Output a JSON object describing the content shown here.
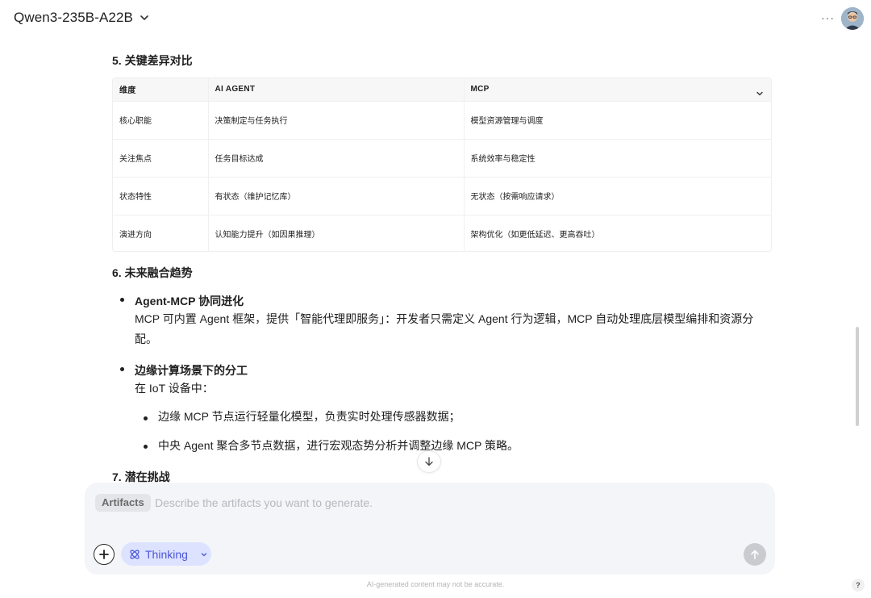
{
  "header": {
    "model_name": "Qwen3-235B-A22B",
    "more_label": "···"
  },
  "content": {
    "section5_title": "5. 关键差异对比",
    "table": {
      "headers": [
        "维度",
        "AI AGENT",
        "MCP"
      ],
      "rows": [
        [
          "核心职能",
          "决策制定与任务执行",
          "模型资源管理与调度"
        ],
        [
          "关注焦点",
          "任务目标达成",
          "系统效率与稳定性"
        ],
        [
          "状态特性",
          "有状态（维护记忆库）",
          "无状态（按需响应请求）"
        ],
        [
          "演进方向",
          "认知能力提升（如因果推理）",
          "架构优化（如更低延迟、更高吞吐）"
        ]
      ]
    },
    "section6_title": "6. 未来融合趋势",
    "item1_title": "Agent-MCP 协同进化",
    "item1_text": "MCP 可内置 Agent 框架，提供「智能代理即服务」：开发者只需定义 Agent 行为逻辑，MCP 自动处理底层模型编排和资源分配。",
    "item2_title": "边缘计算场景下的分工",
    "item2_text": "在 IoT 设备中：",
    "sub1": "边缘 MCP 节点运行轻量化模型，负责实时处理传感器数据；",
    "sub2": "中央 Agent 聚合多节点数据，进行宏观态势分析并调整边缘 MCP 策略。",
    "section7_title": "7. 潜在挑战"
  },
  "composer": {
    "artifacts_tag": "Artifacts",
    "placeholder": "Describe the artifacts you want to generate.",
    "thinking_label": "Thinking"
  },
  "footer": {
    "disclaimer": "AI-generated content may not be accurate.",
    "help": "?"
  },
  "colors": {
    "accent": "#4b55d8",
    "thinking_bg": "#dde3ff",
    "composer_bg": "#f4f5f8",
    "send_disabled": "#c9cbd1"
  }
}
